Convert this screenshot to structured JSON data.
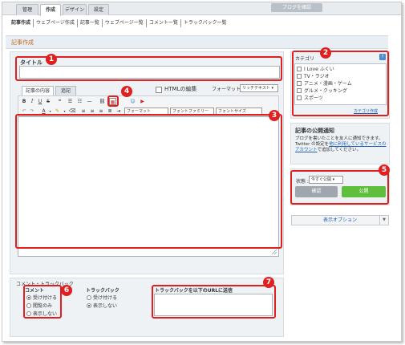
{
  "tabs": [
    "管理",
    "作成",
    "デザイン",
    "設定"
  ],
  "blog_button": "ブログを確認",
  "subnav": [
    "記事作成",
    "ウェブページ作成",
    "記事一覧",
    "ウェブページ一覧",
    "コメント一覧",
    "トラックバック一覧"
  ],
  "section_title": "記事作成",
  "title_label": "タイトル",
  "editor_tabs": [
    "記事の内容",
    "追記"
  ],
  "html_edit_label": "HTMLの編集",
  "format_label": "フォーマット :",
  "format_value": "リッチテキスト",
  "toolbar": {
    "bold": "B",
    "italic": "I",
    "underline": "U",
    "strike": "S",
    "font_color": "A",
    "format_select": "フォーマット",
    "font_family_select": "フォントファミリー",
    "font_size_select": "フォントサイズ"
  },
  "category": {
    "title": "カテゴリ",
    "help": "?",
    "items": [
      "I Love ふくい",
      "TV・ラジオ",
      "アニメ・漫画・ゲーム",
      "グルメ・クッキング",
      "スポーツ"
    ],
    "create_link": "カテゴリ作成"
  },
  "notify": {
    "title": "記事の公開通知",
    "text_before": "ブログを書いたことを友人に通知できます。Twitter の設定を",
    "link": "他に利用しているサービスのアカウント",
    "text_after": "で追加してください。"
  },
  "publish": {
    "status_label": "状態 :",
    "status_value": "今すぐ公開",
    "confirm_button": "確認",
    "publish_button": "公開"
  },
  "display_options": "表示オプション",
  "comment_trackback": {
    "title": "コメント・トラックバック",
    "comment_title": "コメント",
    "comment_options": [
      "受け付ける",
      "閲覧のみ",
      "表示しない"
    ],
    "trackback_title": "トラックバック",
    "trackback_options": [
      "受け付ける",
      "表示しない"
    ],
    "send_title": "トラックバックを以下のURLに送信"
  },
  "callouts": [
    "1",
    "2",
    "3",
    "4",
    "5",
    "6",
    "7"
  ],
  "colors": {
    "highlight": "#e02020",
    "publish": "#5fbf3c",
    "section_title": "#c46a23"
  }
}
